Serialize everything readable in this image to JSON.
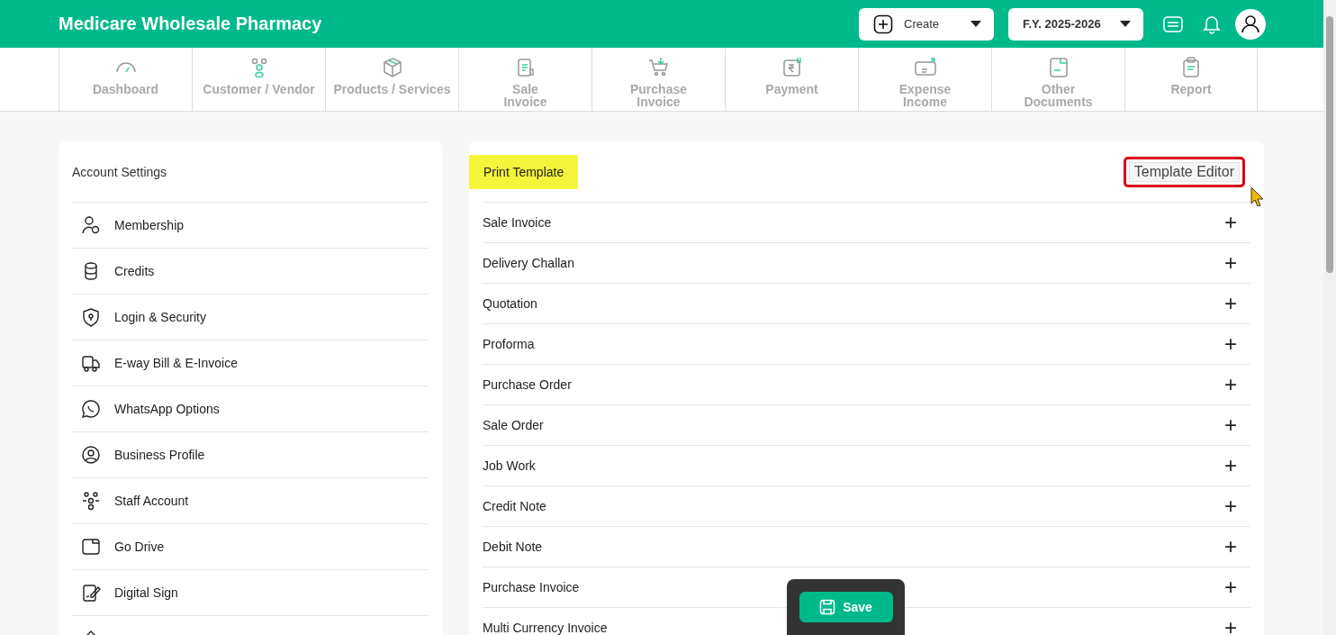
{
  "app_title": "Medicare Wholesale Pharmacy",
  "header": {
    "create_button": "Create",
    "fy_selector": "F.Y. 2025-2026"
  },
  "nav": [
    {
      "kind": "gauge",
      "lines": [
        "Dashboard"
      ]
    },
    {
      "kind": "people",
      "lines": [
        "Customer / Vendor"
      ]
    },
    {
      "kind": "box",
      "lines": [
        "Products / Services"
      ]
    },
    {
      "kind": "receipt",
      "lines": [
        "Sale",
        "Invoice"
      ]
    },
    {
      "kind": "cart",
      "lines": [
        "Purchase",
        "Invoice"
      ]
    },
    {
      "kind": "rupee",
      "lines": [
        "Payment"
      ]
    },
    {
      "kind": "wallet",
      "lines": [
        "Expense",
        "Income"
      ]
    },
    {
      "kind": "document",
      "lines": [
        "Other",
        "Documents"
      ]
    },
    {
      "kind": "clipboard",
      "lines": [
        "Report"
      ]
    }
  ],
  "sidebar": {
    "title": "Account Settings",
    "items": [
      {
        "kind": "member",
        "label": "Membership"
      },
      {
        "kind": "coins",
        "label": "Credits"
      },
      {
        "kind": "shield",
        "label": "Login & Security"
      },
      {
        "kind": "truck",
        "label": "E-way Bill & E-Invoice"
      },
      {
        "kind": "chat",
        "label": "WhatsApp Options"
      },
      {
        "kind": "profile",
        "label": "Business Profile"
      },
      {
        "kind": "staff",
        "label": "Staff Account"
      },
      {
        "kind": "folder",
        "label": "Go Drive"
      },
      {
        "kind": "sign",
        "label": "Digital Sign"
      },
      {
        "kind": "upload"
      }
    ]
  },
  "panel": {
    "title": "Print Template",
    "title_highlighted": true,
    "editor_button": "Template Editor",
    "editor_outlined": true,
    "rows": [
      "Sale Invoice",
      "Delivery Challan",
      "Quotation",
      "Proforma",
      "Purchase Order",
      "Sale Order",
      "Job Work",
      "Credit Note",
      "Debit Note",
      "Purchase Invoice",
      "Multi Currency Invoice"
    ],
    "expand_symbol": "+"
  },
  "save_button": "Save"
}
